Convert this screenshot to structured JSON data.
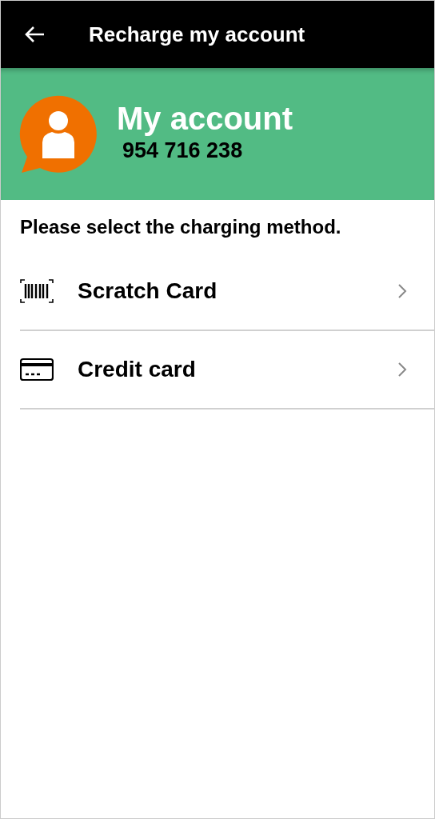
{
  "app_bar": {
    "title": "Recharge my account"
  },
  "account": {
    "title": "My account",
    "number": "954 716 238"
  },
  "prompt": "Please select the charging method.",
  "methods": [
    {
      "kind": "barcode",
      "label": "Scratch Card"
    },
    {
      "kind": "card",
      "label": "Credit card"
    }
  ]
}
